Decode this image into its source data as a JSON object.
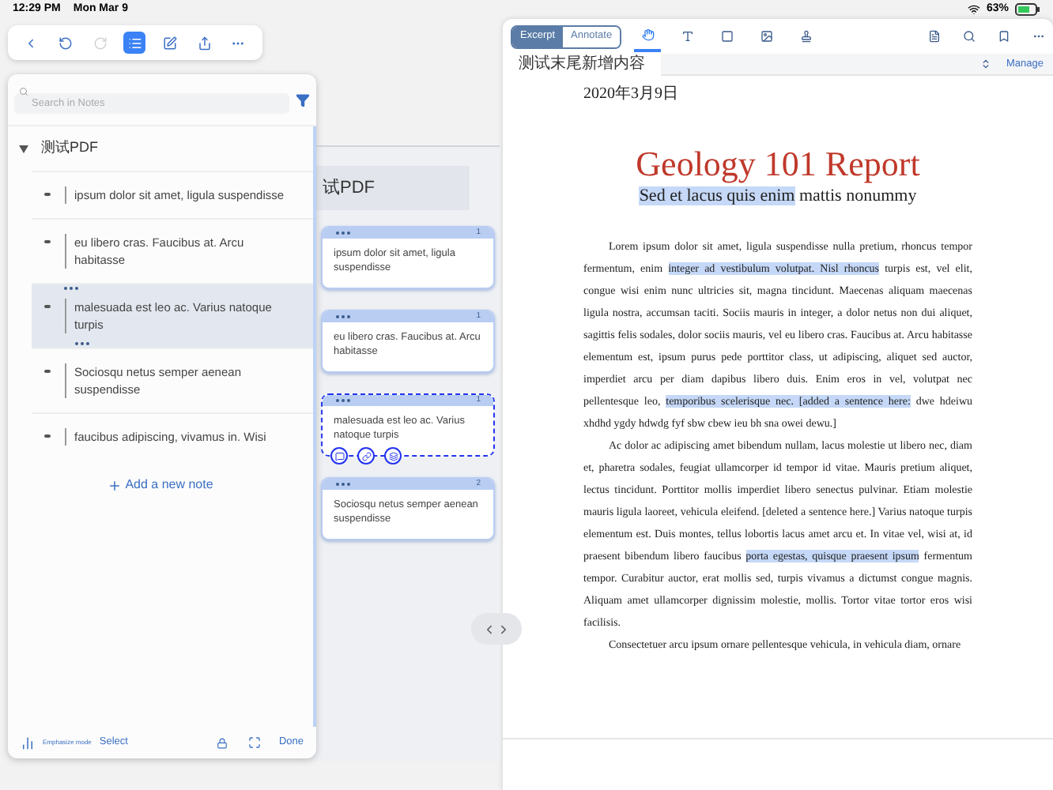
{
  "status_bar": {
    "time": "12:29 PM",
    "date": "Mon Mar 9",
    "battery": "63%"
  },
  "left_toolbar": {
    "buttons": [
      {
        "kind": "back",
        "selected": false,
        "disabled": false
      },
      {
        "kind": "undo",
        "selected": false,
        "disabled": false
      },
      {
        "kind": "redo",
        "selected": false,
        "disabled": true
      },
      {
        "kind": "list",
        "selected": true,
        "disabled": false
      },
      {
        "kind": "edit",
        "selected": false,
        "disabled": false
      },
      {
        "kind": "share",
        "selected": false,
        "disabled": false
      },
      {
        "kind": "more",
        "selected": false,
        "disabled": false
      }
    ]
  },
  "notes_panel": {
    "search": {
      "placeholder": "Search in Notes"
    },
    "tree": [
      {
        "label": "测试PDF",
        "expanded": true,
        "children": [
          {
            "text": "ipsum dolor sit amet, ligula suspendisse",
            "selected": false
          },
          {
            "text": "eu libero cras. Faucibus at. Arcu habitasse",
            "selected": false
          },
          {
            "text": "malesuada est leo ac. Varius natoque turpis",
            "selected": true
          },
          {
            "text": "Sociosqu netus semper aenean suspendisse",
            "selected": false
          },
          {
            "text": "faucibus adipiscing, vivamus in. Wisi",
            "selected": false
          }
        ]
      }
    ],
    "add_note": "Add a new note",
    "footer": {
      "mode_label": "Emphasize mode",
      "select": "Select",
      "done": "Done"
    }
  },
  "mind_map": {
    "heading": "试PDF",
    "cards": [
      {
        "text": "ipsum dolor sit amet, ligula suspendisse",
        "number": "1",
        "selected": false
      },
      {
        "text": "eu libero cras. Faucibus at. Arcu habitasse",
        "number": "1",
        "selected": false
      },
      {
        "text": "malesuada est leo ac. Varius natoque turpis",
        "number": "1",
        "selected": true
      },
      {
        "text": "Sociosqu netus semper aenean suspendisse",
        "number": "2",
        "selected": false
      }
    ]
  },
  "reader": {
    "modes": [
      {
        "label": "Excerpt",
        "selected": true
      },
      {
        "label": "Annotate",
        "selected": false
      }
    ],
    "tools": [
      {
        "kind": "hand",
        "selected": true
      },
      {
        "kind": "text",
        "selected": false
      },
      {
        "kind": "rect",
        "selected": false
      },
      {
        "kind": "image",
        "selected": false
      },
      {
        "kind": "stamp",
        "selected": false
      }
    ],
    "tab": "测试末尾新增内容",
    "manage": "Manage",
    "document": {
      "date": "2020年3月9日",
      "title": "Geology 101 Report",
      "subtitle": [
        {
          "text": "Sed et lacus quis enim",
          "highlighted": true
        },
        {
          "text": " mattis nonummy",
          "highlighted": false
        }
      ],
      "paragraphs": [
        [
          {
            "text": "Lorem ipsum dolor sit amet, ligula suspendisse nulla pretium, rhoncus tempor fermentum, enim ",
            "highlighted": false
          },
          {
            "text": "integer ad vestibulum volutpat. Nisl rhoncus",
            "highlighted": true
          },
          {
            "text": " turpis est, vel elit, congue wisi enim nunc ultricies sit, magna tincidunt. Maecenas aliquam maecenas ligula nostra, accumsan taciti. Sociis mauris in integer, a dolor netus non dui aliquet, sagittis felis sodales, dolor sociis mauris, vel eu libero cras. Faucibus at. Arcu habitasse elementum est, ipsum purus pede porttitor class, ut adipiscing, aliquet sed auctor, imperdiet arcu per diam dapibus libero duis. Enim eros in vel, volutpat nec pellentesque leo, ",
            "highlighted": false
          },
          {
            "text": "temporibus scelerisque nec. [added a sentence here:",
            "highlighted": true
          },
          {
            "text": " dwe hdeiwu xhdhd ygdy hdwdg fyf sbw cbew ieu bh sna owei dewu.]",
            "highlighted": false
          }
        ],
        [
          {
            "text": "Ac dolor ac adipiscing amet bibendum nullam, lacus molestie ut libero nec, diam et, pharetra sodales, feugiat ullamcorper id tempor id vitae. Mauris pretium aliquet, lectus tincidunt. Porttitor mollis imperdiet libero senectus pulvinar. Etiam molestie mauris ligula laoreet, vehicula eleifend. [deleted a sentence here.] Varius natoque turpis elementum est. Duis montes, tellus lobortis lacus amet arcu et. In vitae vel, wisi at, id praesent bibendum libero faucibus ",
            "highlighted": false
          },
          {
            "text": "porta egestas, quisque praesent ipsum",
            "highlighted": true
          },
          {
            "text": " fermentum tempor. Curabitur auctor, erat mollis sed, turpis vivamus a dictumst congue magnis. Aliquam amet ullamcorper dignissim molestie, mollis. Tortor vitae tortor eros wisi facilisis.",
            "highlighted": false
          }
        ],
        [
          {
            "text": "Consectetuer arcu ipsum ornare pellentesque vehicula, in vehicula diam, ornare",
            "highlighted": false
          }
        ]
      ]
    }
  }
}
